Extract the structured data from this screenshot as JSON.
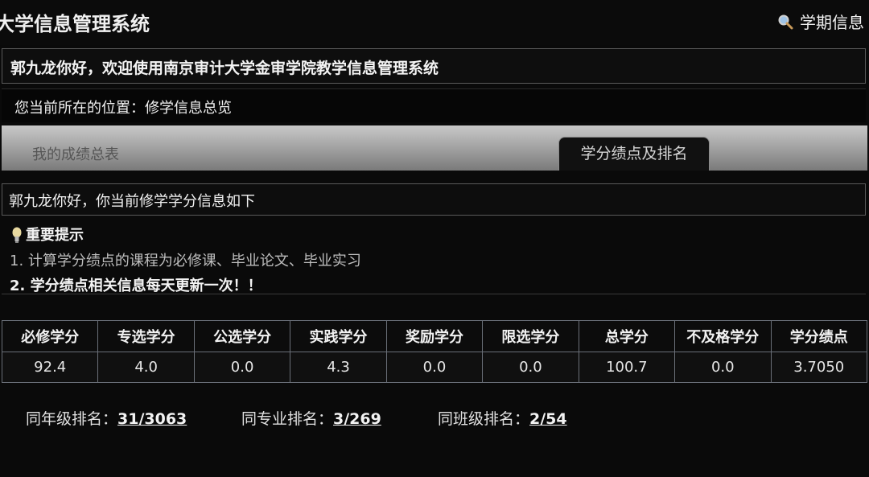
{
  "header": {
    "title": "大学信息管理系统",
    "term_link": "学期信息"
  },
  "welcome": "郭九龙你好，欢迎使用南京审计大学金审学院教学信息管理系统",
  "location": "您当前所在的位置：修学信息总览",
  "tabs": [
    {
      "label": "我的成绩总表",
      "active": false
    },
    {
      "label": "学分绩点及排名",
      "active": true
    }
  ],
  "subheading": "郭九龙你好，你当前修学学分信息如下",
  "tips": {
    "title": "重要提示",
    "items": [
      "1. 计算学分绩点的课程为必修课、毕业论文、毕业实习",
      "2. 学分绩点相关信息每天更新一次！！"
    ]
  },
  "credits_table": {
    "headers": [
      "必修学分",
      "专选学分",
      "公选学分",
      "实践学分",
      "奖励学分",
      "限选学分",
      "总学分",
      "不及格学分",
      "学分绩点"
    ],
    "values": [
      "92.4",
      "4.0",
      "0.0",
      "4.3",
      "0.0",
      "0.0",
      "100.7",
      "0.0",
      "3.7050"
    ]
  },
  "rankings": [
    {
      "label": "同年级排名：",
      "value": "31/3063"
    },
    {
      "label": "同专业排名：",
      "value": "3/269"
    },
    {
      "label": "同班级排名：",
      "value": "2/54"
    }
  ],
  "colors": {
    "background": "#0a0a0a",
    "tab_bar": "#a8a8a8",
    "table_border": "#6a6f78"
  }
}
